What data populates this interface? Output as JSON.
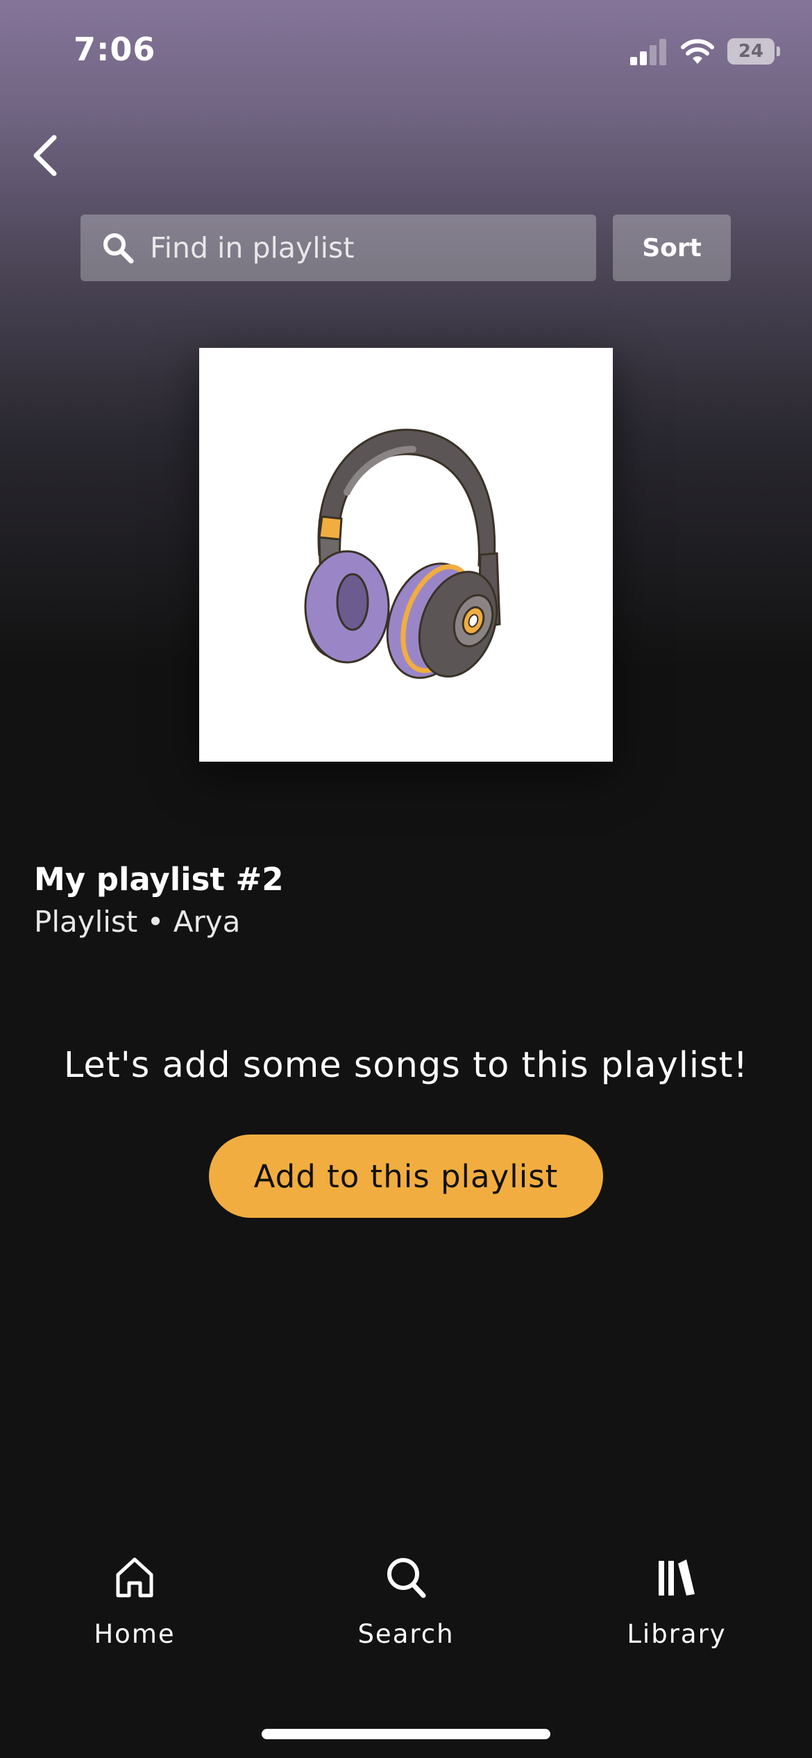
{
  "status_bar": {
    "time": "7:06",
    "battery": "24"
  },
  "header": {
    "back_icon": "chevron-left-icon",
    "search": {
      "placeholder": "Find in playlist",
      "value": "",
      "icon": "search-icon"
    },
    "sort_label": "Sort"
  },
  "playlist": {
    "cover_icon": "headphones-icon",
    "title": "My playlist #2",
    "subtitle": "Playlist • Arya"
  },
  "empty_state": {
    "message": "Let's add some songs to this playlist!",
    "button_label": "Add to this playlist"
  },
  "bottom_nav": {
    "items": [
      {
        "label": "Home",
        "icon": "home-icon"
      },
      {
        "label": "Search",
        "icon": "search-icon"
      },
      {
        "label": "Library",
        "icon": "library-icon"
      }
    ]
  },
  "colors": {
    "accent": "#f1ad40",
    "background": "#121212",
    "header_gradient_top": "#857599"
  }
}
